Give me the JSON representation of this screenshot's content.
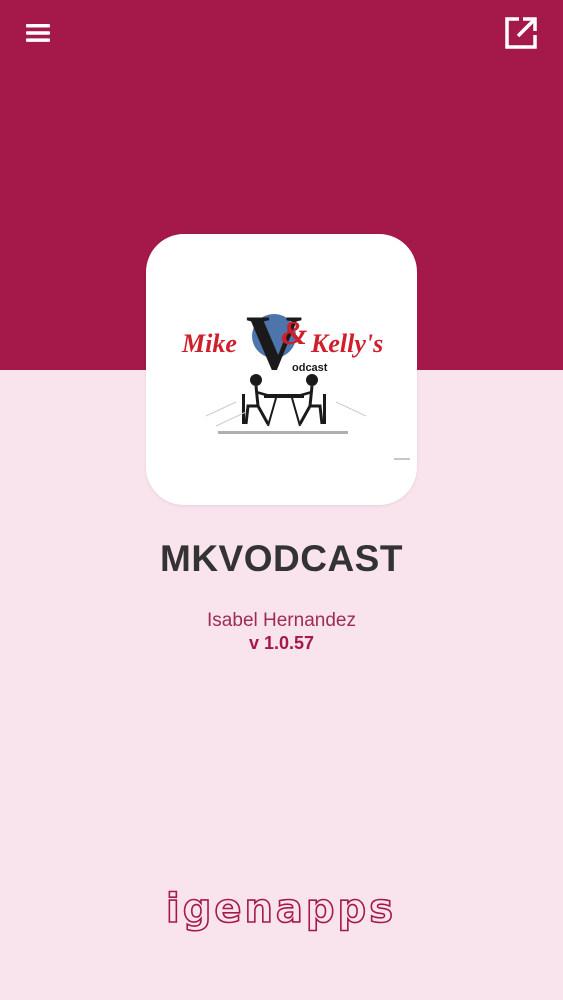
{
  "header": {
    "menu_icon": "hamburger-menu-icon",
    "share_icon": "external-link-icon"
  },
  "app": {
    "logo_text_left": "Mike",
    "logo_text_right": "Kelly's",
    "logo_ampersand": "&",
    "logo_v": "V",
    "logo_sub": "odcast",
    "name": "MKVODCAST",
    "author": "Isabel Hernandez",
    "version": "v 1.0.57"
  },
  "footer": {
    "brand": "igenapps"
  },
  "colors": {
    "primary": "#a5184a",
    "background_light": "#f9e3ec",
    "title_text": "#333333",
    "logo_red": "#d01f2c"
  }
}
